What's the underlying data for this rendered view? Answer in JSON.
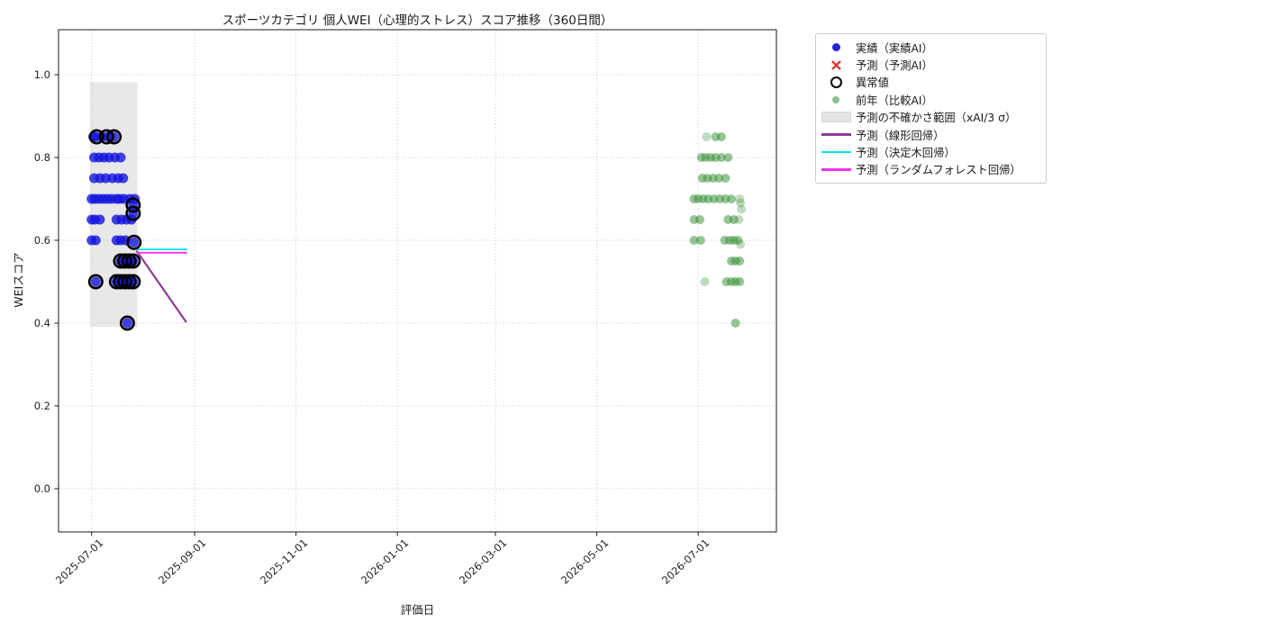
{
  "title": "スポーツカテゴリ 個人WEI（心理的ストレス）スコア推移（360日間）",
  "axes": {
    "xlabel": "評価日",
    "ylabel": "WEIスコア"
  },
  "legend": {
    "items": [
      {
        "label": "実績（実績AI）",
        "marker": "dot",
        "color": "#2424e0",
        "icon": "actual-dot-icon"
      },
      {
        "label": "予測（予測AI）",
        "marker": "x",
        "color": "#e03434",
        "icon": "forecast-x-icon"
      },
      {
        "label": "異常値",
        "marker": "ring",
        "color": "#000000",
        "icon": "anomaly-ring-icon"
      },
      {
        "label": "前年（比較AI）",
        "marker": "dot-small",
        "color": "#3c9a3c",
        "icon": "prev-year-dot-icon"
      },
      {
        "label": "予測の不確かさ範囲（xAI/3 σ）",
        "marker": "patch",
        "color": "#e4e4e4",
        "icon": "uncertainty-band-swatch"
      },
      {
        "label": "予測（線形回帰）",
        "marker": "line",
        "color": "#8f3a96",
        "icon": "linear-regression-line-icon"
      },
      {
        "label": "予測（決定木回帰）",
        "marker": "line",
        "color": "#00e5f5",
        "icon": "decision-tree-line-icon"
      },
      {
        "label": "予測（ランダムフォレスト回帰）",
        "marker": "line",
        "color": "#fузf",
        "icon": "random-forest-line-icon"
      }
    ]
  },
  "chart_data": {
    "type": "scatter",
    "title": "スポーツカテゴリ 個人WEI（心理的ストレス）スコア推移（360日間）",
    "xlabel": "評価日",
    "ylabel": "WEIスコア",
    "grid": true,
    "legend_position": "outside-upper-right",
    "x_axis": {
      "unit": "days_since_2025-07-01",
      "range_days": [
        -20,
        412
      ],
      "ticks": [
        {
          "label": "2025-07-01",
          "day": 0
        },
        {
          "label": "2025-09-01",
          "day": 62
        },
        {
          "label": "2025-11-01",
          "day": 123
        },
        {
          "label": "2026-01-01",
          "day": 184
        },
        {
          "label": "2026-03-01",
          "day": 243
        },
        {
          "label": "2026-05-01",
          "day": 304
        },
        {
          "label": "2026-07-01",
          "day": 365
        }
      ]
    },
    "y_axis": {
      "range": [
        -0.104,
        1.109
      ],
      "ticks": [
        0.0,
        0.2,
        0.4,
        0.6,
        0.8,
        1.0
      ],
      "tick_labels": [
        "0.0",
        "0.2",
        "0.4",
        "0.6",
        "0.8",
        "1.0"
      ]
    },
    "series": [
      {
        "name": "実績（実績AI）",
        "type": "scatter",
        "color": "#1414dc",
        "alpha": 0.8,
        "marker_radius": 5.5,
        "points": [
          [
            1,
            0.85
          ],
          [
            2.5,
            0.85
          ],
          [
            6,
            0.85
          ],
          [
            9.5,
            0.85
          ],
          [
            13.5,
            0.85
          ],
          [
            1.5,
            0.8
          ],
          [
            4.5,
            0.8
          ],
          [
            7.5,
            0.8
          ],
          [
            10.5,
            0.8
          ],
          [
            14,
            0.8
          ],
          [
            17.5,
            0.8
          ],
          [
            1.5,
            0.75
          ],
          [
            5,
            0.75
          ],
          [
            8.5,
            0.75
          ],
          [
            12.5,
            0.75
          ],
          [
            16,
            0.75
          ],
          [
            19,
            0.75
          ],
          [
            0,
            0.7
          ],
          [
            2,
            0.7
          ],
          [
            4.5,
            0.7
          ],
          [
            7,
            0.7
          ],
          [
            9.5,
            0.7
          ],
          [
            12,
            0.7
          ],
          [
            15,
            0.7
          ],
          [
            17,
            0.7
          ],
          [
            19.5,
            0.7
          ],
          [
            23,
            0.7
          ],
          [
            26,
            0.7
          ],
          [
            25,
            0.685
          ],
          [
            25,
            0.665
          ],
          [
            0,
            0.65
          ],
          [
            2,
            0.65
          ],
          [
            5,
            0.65
          ],
          [
            15,
            0.65
          ],
          [
            18,
            0.65
          ],
          [
            21,
            0.65
          ],
          [
            24,
            0.65
          ],
          [
            0,
            0.6
          ],
          [
            2.5,
            0.6
          ],
          [
            15,
            0.6
          ],
          [
            17.5,
            0.6
          ],
          [
            20.5,
            0.6
          ],
          [
            25.5,
            0.595
          ],
          [
            17.5,
            0.55
          ],
          [
            20,
            0.55
          ],
          [
            22.5,
            0.55
          ],
          [
            25,
            0.55
          ],
          [
            2.5,
            0.5
          ],
          [
            15,
            0.5
          ],
          [
            17.5,
            0.5
          ],
          [
            20,
            0.5
          ],
          [
            22.5,
            0.5
          ],
          [
            25,
            0.5
          ],
          [
            21.5,
            0.4
          ]
        ]
      },
      {
        "name": "異常値",
        "type": "scatter_open",
        "color": "#000000",
        "ring_radius": 7.2,
        "points": [
          [
            3,
            0.85
          ],
          [
            9,
            0.85
          ],
          [
            13.5,
            0.85
          ],
          [
            25,
            0.685
          ],
          [
            25,
            0.665
          ],
          [
            25.5,
            0.595
          ],
          [
            17.5,
            0.55
          ],
          [
            20,
            0.55
          ],
          [
            22.5,
            0.55
          ],
          [
            25,
            0.55
          ],
          [
            2.5,
            0.5
          ],
          [
            15,
            0.5
          ],
          [
            17.5,
            0.5
          ],
          [
            20,
            0.5
          ],
          [
            22.5,
            0.5
          ],
          [
            25,
            0.5
          ],
          [
            21.5,
            0.4
          ]
        ]
      },
      {
        "name": "前年（比較AI）",
        "type": "scatter",
        "color": "#2e8b2e",
        "alpha": 0.5,
        "marker_radius": 5,
        "points": [
          [
            375.5,
            0.85
          ],
          [
            379,
            0.85
          ],
          [
            367,
            0.8
          ],
          [
            369.5,
            0.8
          ],
          [
            372.5,
            0.8
          ],
          [
            375.5,
            0.8
          ],
          [
            379,
            0.8
          ],
          [
            383,
            0.8
          ],
          [
            367.5,
            0.75
          ],
          [
            370.5,
            0.75
          ],
          [
            374,
            0.75
          ],
          [
            377.5,
            0.75
          ],
          [
            381.5,
            0.75
          ],
          [
            362.5,
            0.7
          ],
          [
            365,
            0.7
          ],
          [
            368,
            0.7
          ],
          [
            371,
            0.7
          ],
          [
            374.5,
            0.7
          ],
          [
            378,
            0.7
          ],
          [
            381.5,
            0.7
          ],
          [
            385,
            0.7
          ],
          [
            362.5,
            0.65
          ],
          [
            366,
            0.65
          ],
          [
            383,
            0.65
          ],
          [
            386.5,
            0.65
          ],
          [
            362.5,
            0.6
          ],
          [
            366.5,
            0.6
          ],
          [
            381,
            0.6
          ],
          [
            384,
            0.6
          ],
          [
            386.5,
            0.6
          ],
          [
            389,
            0.6
          ],
          [
            385,
            0.55
          ],
          [
            387.5,
            0.55
          ],
          [
            390,
            0.55
          ],
          [
            382,
            0.5
          ],
          [
            385,
            0.5
          ],
          [
            387.5,
            0.5
          ],
          [
            390,
            0.5
          ],
          [
            387.5,
            0.4
          ]
        ],
        "points_light": [
          [
            370,
            0.85
          ],
          [
            390,
            0.7
          ],
          [
            390.5,
            0.69
          ],
          [
            391,
            0.675
          ],
          [
            389.5,
            0.65
          ],
          [
            390.5,
            0.59
          ],
          [
            369,
            0.5
          ]
        ]
      },
      {
        "name": "予測の不確かさ範囲（xAI/3 σ）",
        "type": "band",
        "x_days": [
          -1,
          27.6
        ],
        "y_range": [
          0.391,
          0.982
        ],
        "color": "#d8d8d8"
      },
      {
        "name": "予測（線形回帰）",
        "type": "line",
        "color": "#8f3a96",
        "width": 2.2,
        "points": [
          [
            27,
            0.575
          ],
          [
            57,
            0.402
          ]
        ]
      },
      {
        "name": "予測（決定木回帰）",
        "type": "line",
        "color": "#00e5f5",
        "width": 1.8,
        "points": [
          [
            26.9,
            0.578
          ],
          [
            57.5,
            0.578
          ]
        ]
      },
      {
        "name": "予測（ランダムフォレスト回帰）",
        "type": "line",
        "color": "#f531f5",
        "width": 1.8,
        "points": [
          [
            26.9,
            0.57
          ],
          [
            57.5,
            0.57
          ]
        ]
      }
    ]
  }
}
